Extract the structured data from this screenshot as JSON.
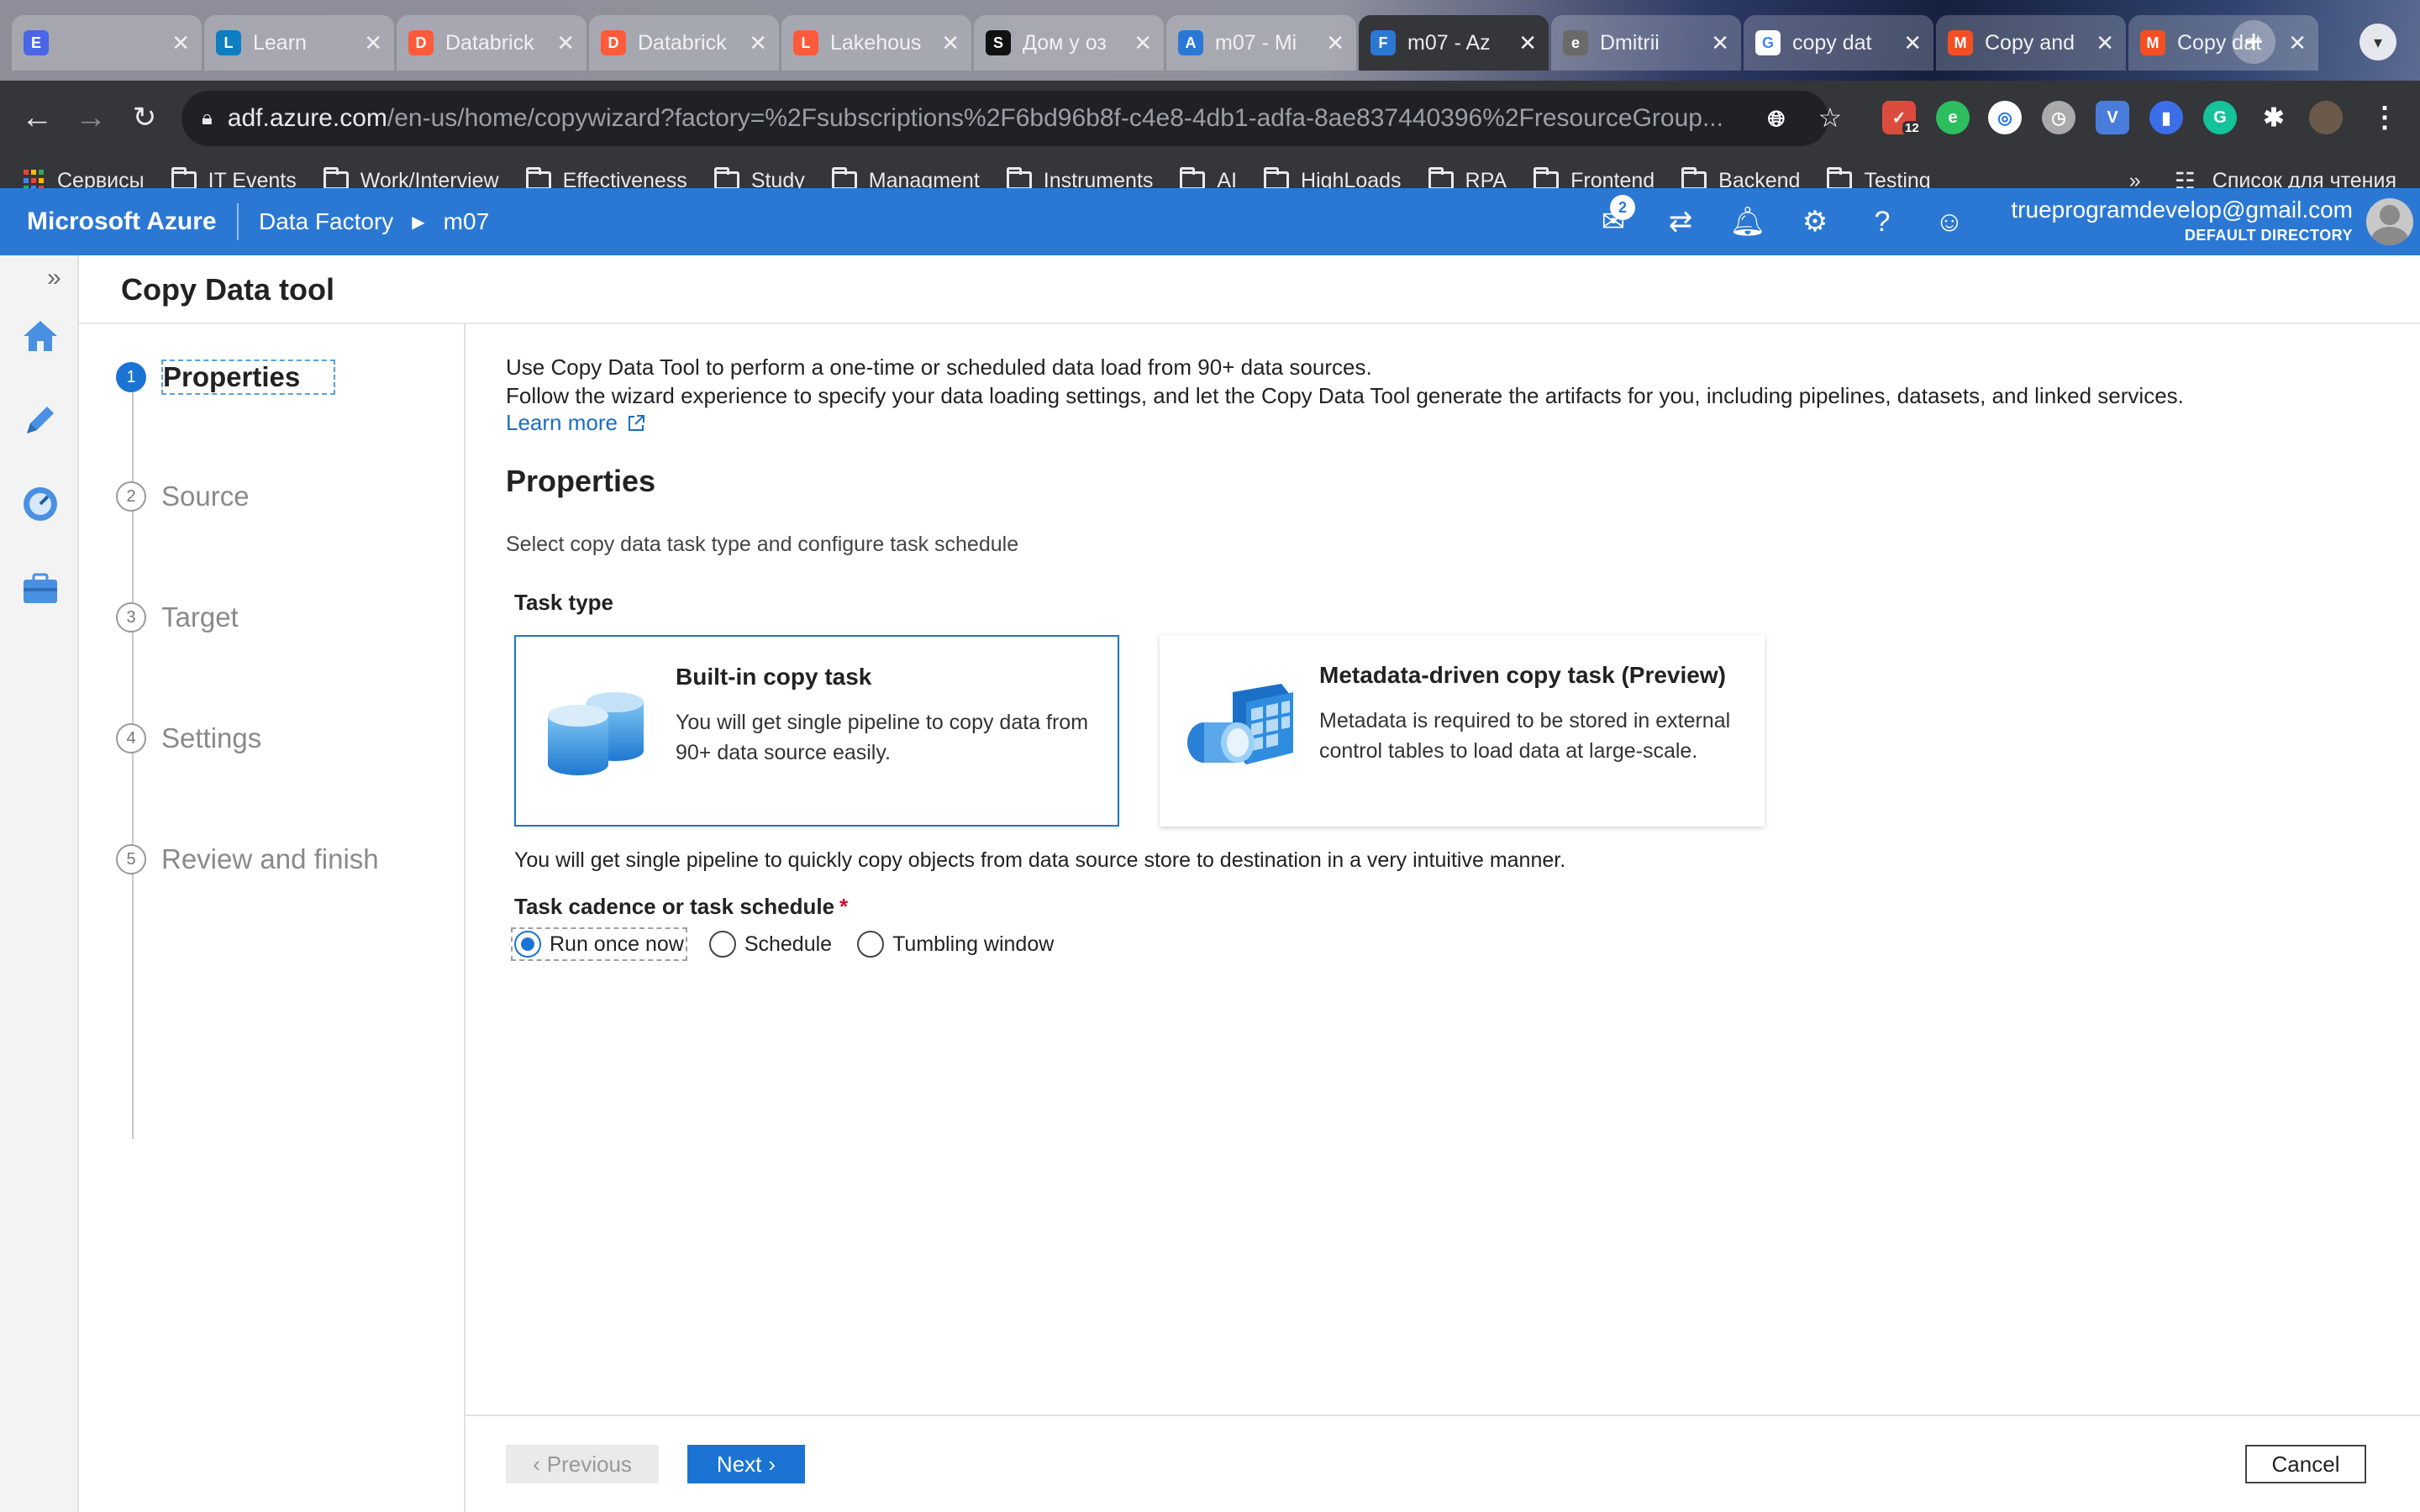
{
  "browser": {
    "tabs": [
      {
        "title": "",
        "favicon": "E",
        "color": "#4a66e6"
      },
      {
        "title": "Learn",
        "favicon": "L",
        "color": "#0d7ec1"
      },
      {
        "title": "Databrick",
        "favicon": "D",
        "color": "#ff5a3c"
      },
      {
        "title": "Databrick",
        "favicon": "D",
        "color": "#ff5a3c"
      },
      {
        "title": "Lakehous",
        "favicon": "L",
        "color": "#ff5a3c"
      },
      {
        "title": "Дом у оз",
        "favicon": "S",
        "color": "#111111"
      },
      {
        "title": "m07 - Mi",
        "favicon": "A",
        "color": "#2b78d4"
      },
      {
        "title": "m07 - Az",
        "favicon": "F",
        "color": "#2b78d4"
      },
      {
        "title": "Dmitrii",
        "favicon": "e",
        "color": "#6a6a6a"
      },
      {
        "title": "copy dat",
        "favicon": "G",
        "color": "#ffffff"
      },
      {
        "title": "Copy and",
        "favicon": "M",
        "color": "#f25022"
      },
      {
        "title": "Copy dat",
        "favicon": "M",
        "color": "#f25022"
      }
    ],
    "close_glyph": "✕",
    "new_tab_glyph": "+",
    "url_host": "adf.azure.com",
    "url_path": "/en-us/home/copywizard?factory=%2Fsubscriptions%2F6bd96b8f-c4e8-4db1-adfa-8ae837440396%2FresourceGroup...",
    "extension_badge": "12",
    "bookmarks": [
      "Сервисы",
      "IT Events",
      "Work/Interview",
      "Effectiveness",
      "Study",
      "Managment",
      "Instruments",
      "AI",
      "HighLoads",
      "RPA",
      "Frontend",
      "Backend",
      "Testing"
    ],
    "bookmarks_overflow": "»",
    "reading_list": "Список для чтения"
  },
  "azure": {
    "brand": "Microsoft Azure",
    "breadcrumb": [
      "Data Factory",
      "m07"
    ],
    "notification_count": "2",
    "account_email": "trueprogramdevelop@gmail.com",
    "account_directory": "DEFAULT DIRECTORY"
  },
  "page": {
    "title": "Copy Data tool",
    "steps": [
      {
        "num": "1",
        "label": "Properties",
        "active": true
      },
      {
        "num": "2",
        "label": "Source",
        "active": false
      },
      {
        "num": "3",
        "label": "Target",
        "active": false
      },
      {
        "num": "4",
        "label": "Settings",
        "active": false
      },
      {
        "num": "5",
        "label": "Review and finish",
        "active": false
      }
    ],
    "intro_line1": "Use Copy Data Tool to perform a one-time or scheduled data load from 90+ data sources.",
    "intro_line2": "Follow the wizard experience to specify your data loading settings, and let the Copy Data Tool generate the artifacts for you, including pipelines, datasets, and linked services.",
    "learn_more": "Learn more",
    "section_title": "Properties",
    "section_subtitle": "Select copy data task type and configure task schedule",
    "task_type_label": "Task type",
    "cards": [
      {
        "title": "Built-in copy task",
        "desc": "You will get single pipeline to copy data from 90+ data source easily.",
        "selected": true
      },
      {
        "title": "Metadata-driven copy task (Preview)",
        "desc": "Metadata is required to be stored in external control tables to load data at large-scale.",
        "selected": false
      }
    ],
    "selected_task_desc": "You will get single pipeline to quickly copy objects from data source store to destination in a very intuitive manner.",
    "cadence_label": "Task cadence or task schedule",
    "required_mark": "*",
    "cadence_options": [
      "Run once now",
      "Schedule",
      "Tumbling window"
    ],
    "cadence_selected": "Run once now"
  },
  "footer": {
    "previous": "Previous",
    "next": "Next",
    "cancel": "Cancel"
  },
  "colors": {
    "azure_blue": "#2b78d4",
    "primary_button": "#1b74d3"
  }
}
